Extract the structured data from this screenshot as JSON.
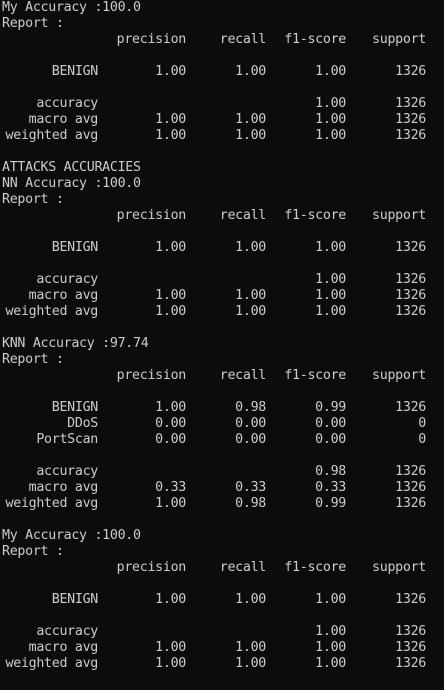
{
  "window": {
    "background": "#0c0c0c",
    "foreground": "#cccccc"
  },
  "blocks": [
    {
      "accuracy_line": "My Accuracy :100.0",
      "report_label": "Report :",
      "header": [
        "precision",
        "recall",
        "f1-score",
        "support"
      ],
      "class_rows": [
        {
          "label": "BENIGN",
          "precision": "1.00",
          "recall": "1.00",
          "f1": "1.00",
          "support": "1326"
        }
      ],
      "summary_rows": [
        {
          "label": "accuracy",
          "precision": "",
          "recall": "",
          "f1": "1.00",
          "support": "1326"
        },
        {
          "label": "macro avg",
          "precision": "1.00",
          "recall": "1.00",
          "f1": "1.00",
          "support": "1326"
        },
        {
          "label": "weighted avg",
          "precision": "1.00",
          "recall": "1.00",
          "f1": "1.00",
          "support": "1326"
        }
      ]
    },
    {
      "section_title": "ATTACKS ACCURACIES",
      "accuracy_line": "NN Accuracy :100.0",
      "report_label": "Report :",
      "header": [
        "precision",
        "recall",
        "f1-score",
        "support"
      ],
      "class_rows": [
        {
          "label": "BENIGN",
          "precision": "1.00",
          "recall": "1.00",
          "f1": "1.00",
          "support": "1326"
        }
      ],
      "summary_rows": [
        {
          "label": "accuracy",
          "precision": "",
          "recall": "",
          "f1": "1.00",
          "support": "1326"
        },
        {
          "label": "macro avg",
          "precision": "1.00",
          "recall": "1.00",
          "f1": "1.00",
          "support": "1326"
        },
        {
          "label": "weighted avg",
          "precision": "1.00",
          "recall": "1.00",
          "f1": "1.00",
          "support": "1326"
        }
      ]
    },
    {
      "accuracy_line": "KNN Accuracy :97.74",
      "report_label": "Report :",
      "header": [
        "precision",
        "recall",
        "f1-score",
        "support"
      ],
      "class_rows": [
        {
          "label": "BENIGN",
          "precision": "1.00",
          "recall": "0.98",
          "f1": "0.99",
          "support": "1326"
        },
        {
          "label": "DDoS",
          "precision": "0.00",
          "recall": "0.00",
          "f1": "0.00",
          "support": "0"
        },
        {
          "label": "PortScan",
          "precision": "0.00",
          "recall": "0.00",
          "f1": "0.00",
          "support": "0"
        }
      ],
      "summary_rows": [
        {
          "label": "accuracy",
          "precision": "",
          "recall": "",
          "f1": "0.98",
          "support": "1326"
        },
        {
          "label": "macro avg",
          "precision": "0.33",
          "recall": "0.33",
          "f1": "0.33",
          "support": "1326"
        },
        {
          "label": "weighted avg",
          "precision": "1.00",
          "recall": "0.98",
          "f1": "0.99",
          "support": "1326"
        }
      ]
    },
    {
      "accuracy_line": "My Accuracy :100.0",
      "report_label": "Report :",
      "header": [
        "precision",
        "recall",
        "f1-score",
        "support"
      ],
      "class_rows": [
        {
          "label": "BENIGN",
          "precision": "1.00",
          "recall": "1.00",
          "f1": "1.00",
          "support": "1326"
        }
      ],
      "summary_rows": [
        {
          "label": "accuracy",
          "precision": "",
          "recall": "",
          "f1": "1.00",
          "support": "1326"
        },
        {
          "label": "macro avg",
          "precision": "1.00",
          "recall": "1.00",
          "f1": "1.00",
          "support": "1326"
        },
        {
          "label": "weighted avg",
          "precision": "1.00",
          "recall": "1.00",
          "f1": "1.00",
          "support": "1326"
        }
      ]
    }
  ]
}
